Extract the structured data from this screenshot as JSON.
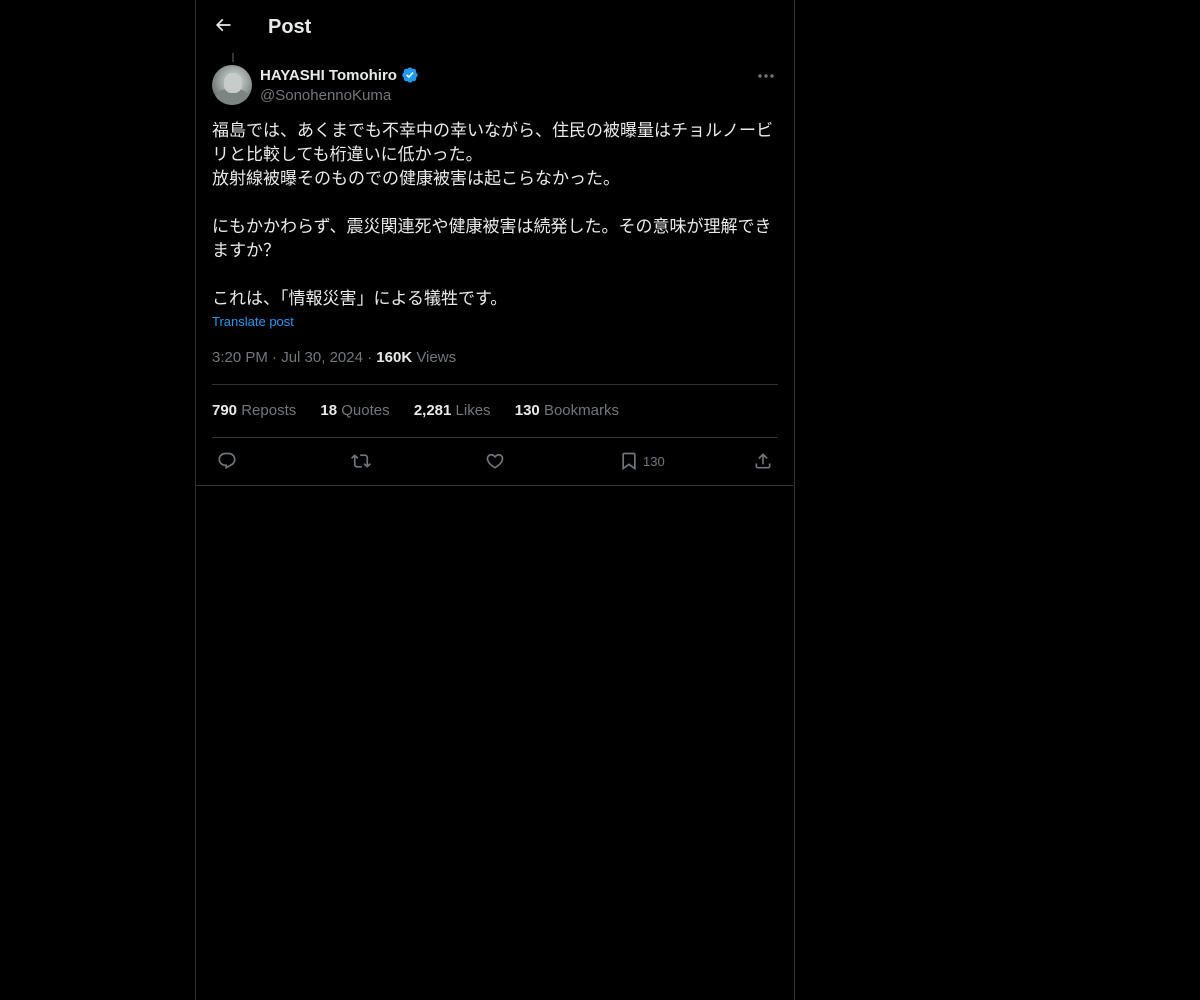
{
  "header": {
    "title": "Post"
  },
  "post": {
    "author_name": "HAYASHI Tomohiro",
    "author_handle": "@SonohennoKuma",
    "text_lines": [
      "福島では、あくまでも不幸中の幸いながら、住民の被曝量はチョルノービ",
      "リと比較しても桁違いに低かった。",
      "放射線被曝そのものでの健康被害は起こらなかった。",
      "",
      "にもかかわらず、震災関連死や健康被害は続発した。その意味が理解でき",
      "ますか？",
      "",
      "これは、「情報災害」による犠牲です。"
    ],
    "translate_label": "Translate post",
    "time": "3:20 PM",
    "date": "Jul 30, 2024",
    "views_count": "160K",
    "views_label": "Views"
  },
  "stats": {
    "reposts_count": "790",
    "reposts_label": "Reposts",
    "quotes_count": "18",
    "quotes_label": "Quotes",
    "likes_count": "2,281",
    "likes_label": "Likes",
    "bookmarks_count": "130",
    "bookmarks_label": "Bookmarks"
  },
  "actions": {
    "bookmark_count": "130"
  },
  "icons": {
    "back": "arrow-left-icon",
    "verified": "verified-badge-icon",
    "more": "more-horizontal-icon",
    "reply": "reply-icon",
    "repost": "repost-icon",
    "like": "heart-icon",
    "bookmark": "bookmark-icon",
    "share": "share-icon"
  },
  "colors": {
    "background": "#000000",
    "text_primary": "#e7e9ea",
    "text_secondary": "#71767b",
    "accent": "#1d9bf0",
    "border": "#2f3336"
  }
}
